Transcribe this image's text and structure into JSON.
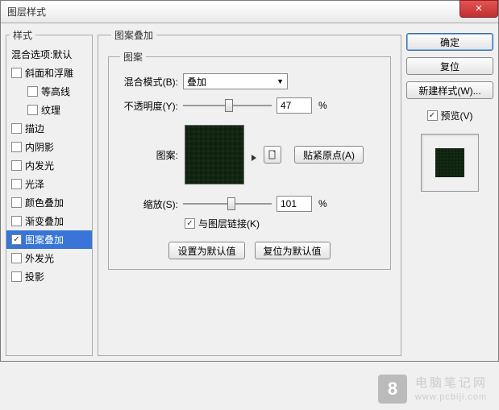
{
  "dialog": {
    "title": "图层样式",
    "close": "✕"
  },
  "styles_panel": {
    "legend": "样式",
    "items": [
      {
        "label": "混合选项:默认",
        "checked": null,
        "indent": false,
        "selected": false
      },
      {
        "label": "斜面和浮雕",
        "checked": false,
        "indent": false,
        "selected": false
      },
      {
        "label": "等高线",
        "checked": false,
        "indent": true,
        "selected": false
      },
      {
        "label": "纹理",
        "checked": false,
        "indent": true,
        "selected": false
      },
      {
        "label": "描边",
        "checked": false,
        "indent": false,
        "selected": false
      },
      {
        "label": "内阴影",
        "checked": false,
        "indent": false,
        "selected": false
      },
      {
        "label": "内发光",
        "checked": false,
        "indent": false,
        "selected": false
      },
      {
        "label": "光泽",
        "checked": false,
        "indent": false,
        "selected": false
      },
      {
        "label": "颜色叠加",
        "checked": false,
        "indent": false,
        "selected": false
      },
      {
        "label": "渐变叠加",
        "checked": false,
        "indent": false,
        "selected": false
      },
      {
        "label": "图案叠加",
        "checked": true,
        "indent": false,
        "selected": true
      },
      {
        "label": "外发光",
        "checked": false,
        "indent": false,
        "selected": false
      },
      {
        "label": "投影",
        "checked": false,
        "indent": false,
        "selected": false
      }
    ]
  },
  "main": {
    "legend_outer": "图案叠加",
    "legend_inner": "图案",
    "blend_mode_label": "混合模式(B):",
    "blend_mode_value": "叠加",
    "opacity_label": "不透明度(Y):",
    "opacity_value": "47",
    "opacity_pct_pos": 47,
    "percent": "%",
    "pattern_label": "图案:",
    "snap_origin": "贴紧原点(A)",
    "scale_label": "缩放(S):",
    "scale_value": "101",
    "scale_pct_pos": 50,
    "link_layer_label": "与图层链接(K)",
    "link_layer_checked": true,
    "set_default": "设置为默认值",
    "reset_default": "复位为默认值"
  },
  "right": {
    "ok": "确定",
    "reset": "复位",
    "new_style": "新建样式(W)...",
    "preview_label": "预览(V)",
    "preview_checked": true
  },
  "watermark": {
    "logo": "8",
    "line1": "电脑笔记网",
    "line2": "www.pcbiji.com"
  }
}
